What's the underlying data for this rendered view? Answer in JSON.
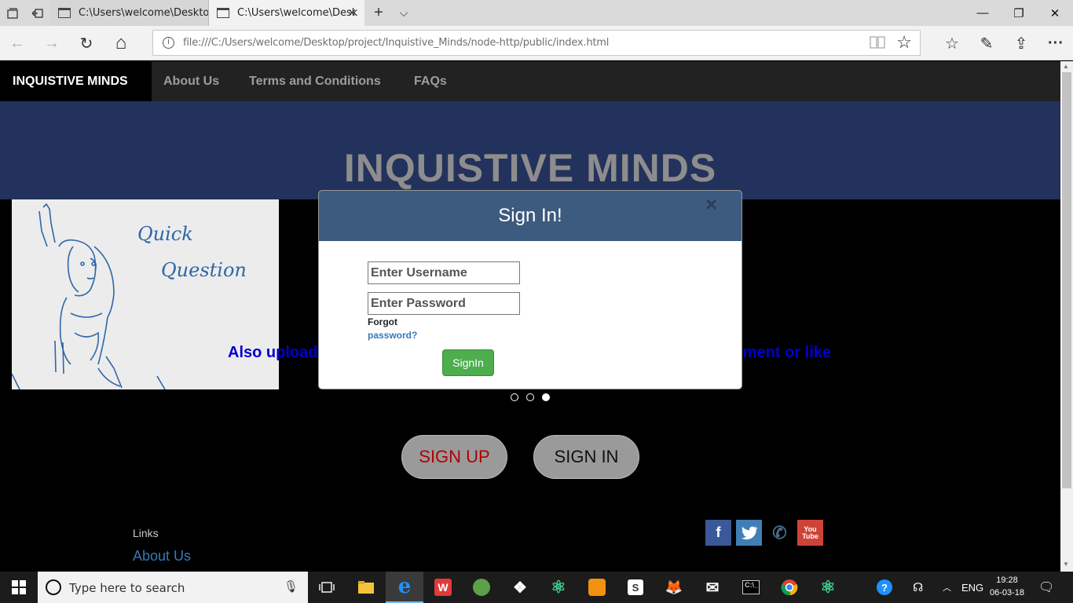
{
  "browser": {
    "tabs": [
      {
        "title": "C:\\Users\\welcome\\Desktop\\",
        "active": false
      },
      {
        "title": "C:\\Users\\welcome\\Desk",
        "active": true
      }
    ],
    "new_tab": "+",
    "tab_list": "⌵",
    "url": "file:///C:/Users/welcome/Desktop/project/Inquistive_Minds/node-http/public/index.html",
    "url_info": "i",
    "window": {
      "minimize": "—",
      "restore": "❐",
      "close": "✕"
    },
    "nav": {
      "back": "←",
      "forward": "→",
      "refresh": "↻",
      "home": "⌂"
    },
    "tools": {
      "favorites": "☆",
      "pen": "✎",
      "share": "⇪",
      "more": "···"
    },
    "fav_star": "☆"
  },
  "site": {
    "brand": "INQUISTIVE MINDS",
    "nav": [
      "About Us",
      "Terms and Conditions",
      "FAQs"
    ],
    "hero_title": "INQUISTIVE MINDS",
    "slide": {
      "img_text_1": "Quick",
      "img_text_2": "Question",
      "caption_left": "Also upload",
      "caption_right": "ment or like"
    },
    "signup_label": "SIGN UP",
    "signin_label": "SIGN IN",
    "footer": {
      "links_title": "Links",
      "about": "About Us"
    },
    "social": {
      "facebook": "f",
      "twitter": "🐦",
      "whatsapp": "✆",
      "youtube": "You Tube"
    }
  },
  "modal": {
    "title": "Sign In!",
    "close": "×",
    "username_placeholder": "Enter Username",
    "password_placeholder": "Enter Password",
    "forgot_1": "Forgot",
    "forgot_2": "password?",
    "submit": "SignIn"
  },
  "taskbar": {
    "search_placeholder": "Type here to search",
    "tray": {
      "lang": "ENG",
      "time": "19:28",
      "date": "06-03-18"
    }
  }
}
